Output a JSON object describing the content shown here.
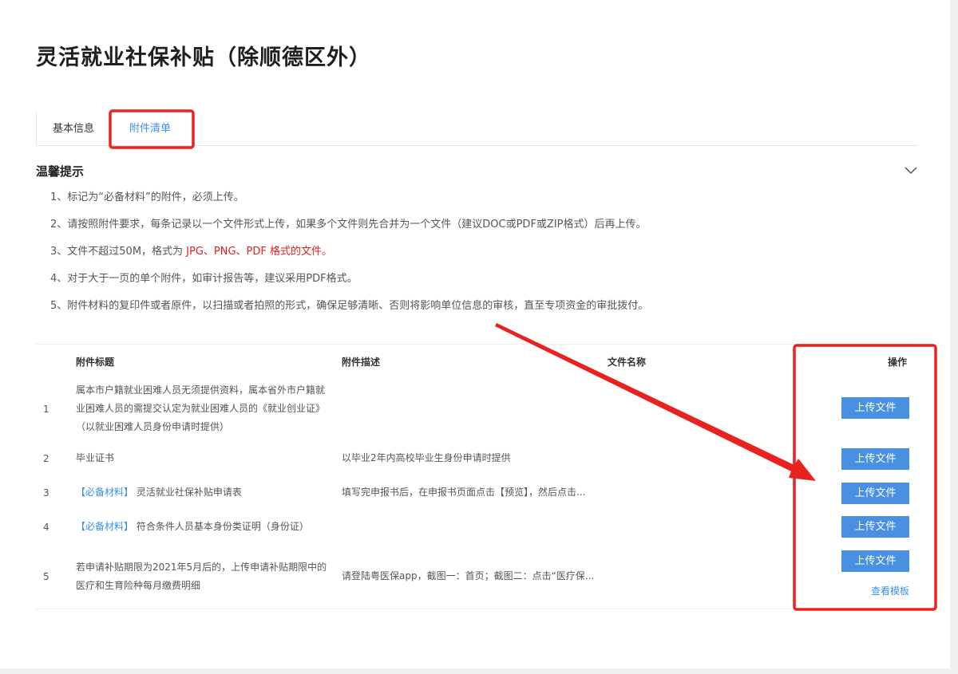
{
  "page": {
    "title": "灵活就业社保补贴（除顺德区外）"
  },
  "tabs": [
    {
      "label": "基本信息"
    },
    {
      "label": "附件清单"
    }
  ],
  "tips": {
    "title": "温馨提示",
    "items": [
      "1、标记为“必备材料”的附件，必须上传。",
      "2、请按照附件要求，每条记录以一个文件形式上传，如果多个文件则先合并为一个文件（建议DOC或PDF或ZIP格式）后再上传。",
      "3、文件不超过50M，格式为 ",
      "4、对于大于一页的单个附件，如审计报告等，建议采用PDF格式。",
      "5、附件材料的复印件或者原件，以扫描或者拍照的形式，确保足够清晰、否则将影响单位信息的审核，直至专项资金的审批拨付。"
    ],
    "item3_red": "JPG、PNG、PDF 格式的文件。"
  },
  "table": {
    "headers": {
      "title": "附件标题",
      "desc": "附件描述",
      "filename": "文件名称",
      "action": "操作"
    },
    "rows": [
      {
        "num": "1",
        "title_lines": [
          "属本市户籍就业困难人员无须提供资料，属本省外市户籍就",
          "业困难人员的需提交认定为就业困难人员的《就业创业证》",
          "（以就业困难人员身份申请时提供）"
        ],
        "desc": "",
        "button": "上传文件"
      },
      {
        "num": "2",
        "title": "毕业证书",
        "desc": "以毕业2年内高校毕业生身份申请时提供",
        "button": "上传文件"
      },
      {
        "num": "3",
        "tag": "【必备材料】",
        "title": "灵活就业社保补贴申请表",
        "desc": "填写完申报书后，在申报书页面点击【预览】，然后点击...",
        "button": "上传文件"
      },
      {
        "num": "4",
        "tag": "【必备材料】",
        "title": "符合条件人员基本身份类证明（身份证）",
        "desc": "",
        "button": "上传文件"
      },
      {
        "num": "5",
        "title_lines": [
          "若申请补贴期限为2021年5月后的，上传申请补贴期限中的",
          "医疗和生育险种每月缴费明细"
        ],
        "desc": "请登陆粤医保app，截图一：首页；截图二：点击“医疗保...",
        "button": "上传文件",
        "link": "查看模板"
      }
    ]
  },
  "colors": {
    "accent": "#4a90e2",
    "annotation": "#e8231f",
    "required_text": "#e02020"
  },
  "icons": {
    "collapse": "chevron-down-icon"
  }
}
